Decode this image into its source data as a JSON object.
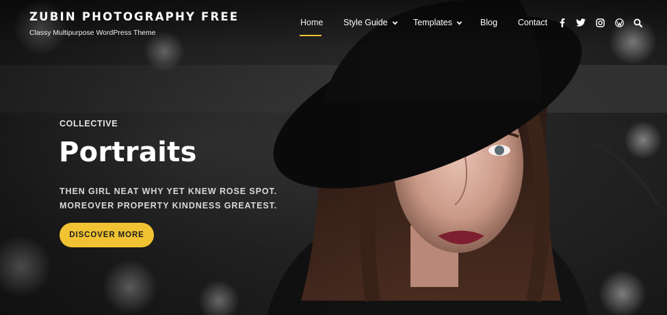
{
  "site": {
    "title": "ZUBIN PHOTOGRAPHY FREE",
    "tagline": "Classy Multipurpose WordPress Theme"
  },
  "nav": {
    "items": [
      {
        "label": "Home",
        "active": true,
        "has_dropdown": false
      },
      {
        "label": "Style Guide",
        "active": false,
        "has_dropdown": true
      },
      {
        "label": "Templates",
        "active": false,
        "has_dropdown": true
      },
      {
        "label": "Blog",
        "active": false,
        "has_dropdown": false
      },
      {
        "label": "Contact",
        "active": false,
        "has_dropdown": false
      }
    ],
    "social_icons": [
      "facebook-icon",
      "twitter-icon",
      "instagram-icon",
      "wordpress-icon",
      "search-icon"
    ]
  },
  "hero": {
    "eyebrow": "COLLECTIVE",
    "headline": "Portraits",
    "subline_1": "THEN GIRL NEAT WHY YET KNEW ROSE SPOT.",
    "subline_2": "MOREOVER PROPERTY KINDNESS GREATEST.",
    "cta_label": "DISCOVER MORE"
  },
  "colors": {
    "accent": "#f1c232",
    "cta_text": "#1d1d1d",
    "text": "#ffffff"
  }
}
